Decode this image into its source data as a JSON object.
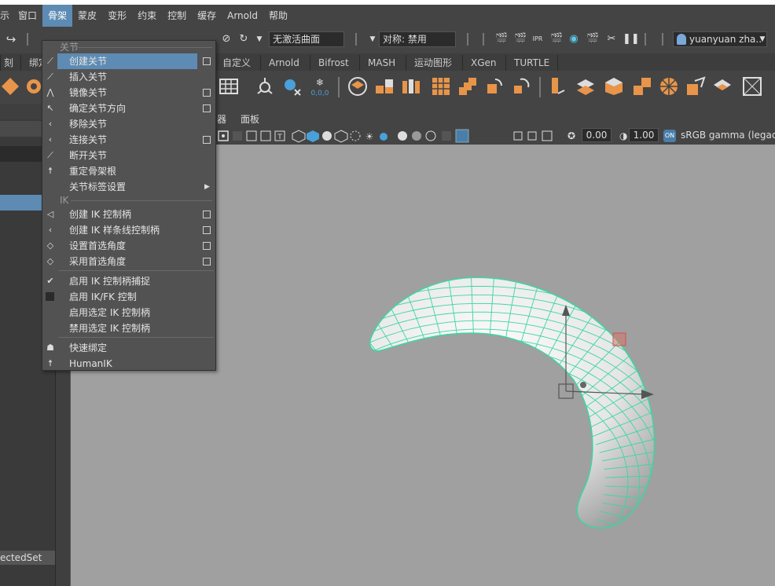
{
  "menubar": {
    "items": [
      "示",
      "窗口",
      "骨架",
      "蒙皮",
      "变形",
      "约束",
      "控制",
      "缓存",
      "Arnold",
      "帮助"
    ],
    "active_index": 2
  },
  "statusline": {
    "surface_field": "无激活曲面",
    "symmetry_field": "对称: 禁用",
    "user": "yuanyuan zha.."
  },
  "shelf": {
    "tabs": [
      "刻",
      "绑定",
      "自定义",
      "Arnold",
      "Bifrost",
      "MASH",
      "运动图形",
      "XGen",
      "TURTLE"
    ]
  },
  "leftpanel": {
    "selected_set": "ectedSet"
  },
  "viewport": {
    "menu": [
      "器",
      "面板"
    ],
    "exposure": "0.00",
    "gamma": "1.00",
    "colorspace": "sRGB gamma (legac"
  },
  "dropdown": {
    "section_joint": "关节",
    "section_ik": "IK",
    "items": {
      "create_joint": "创建关节",
      "insert_joint": "插入关节",
      "mirror_joint": "镜像关节",
      "orient_joint": "确定关节方向",
      "remove_joint": "移除关节",
      "connect_joint": "连接关节",
      "disconnect_joint": "断开关节",
      "reroot": "重定骨架根",
      "joint_labelling": "关节标签设置",
      "create_ik_handle": "创建 IK 控制柄",
      "create_ik_spline": "创建 IK 样条线控制柄",
      "set_preferred_angle": "设置首选角度",
      "assume_preferred_angle": "采用首选角度",
      "enable_ik_snap": "启用 IK 控制柄捕捉",
      "enable_ikfk": "启用 IK/FK 控制",
      "enable_selected_ik": "启用选定 IK 控制柄",
      "disable_selected_ik": "禁用选定 IK 控制柄",
      "quick_rig": "快速绑定",
      "humanik": "HumanIK"
    }
  },
  "colors": {
    "accent": "#5d8bb3",
    "wireframe": "#3cd6a0",
    "shelf_orange": "#e8954a"
  }
}
